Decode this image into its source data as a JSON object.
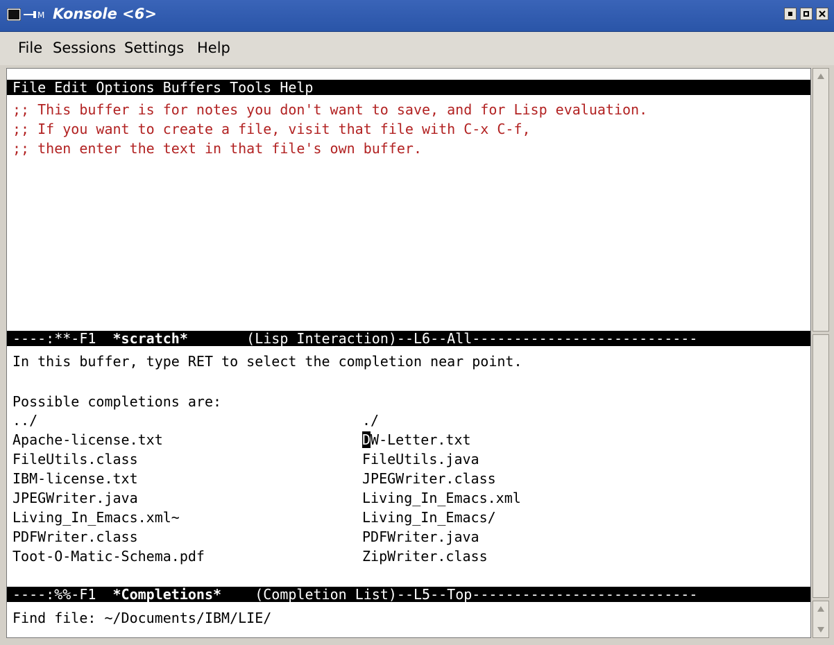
{
  "window": {
    "title": "Konsole <6>"
  },
  "konsole_menu": {
    "items": [
      "File",
      "Sessions",
      "Settings",
      "Help"
    ]
  },
  "emacs_menu": {
    "text": "File Edit Options Buffers Tools Help"
  },
  "scratch": {
    "comments": [
      ";; This buffer is for notes you don't want to save, and for Lisp evaluation.",
      ";; If you want to create a file, visit that file with C-x C-f,",
      ";; then enter the text in that file's own buffer."
    ]
  },
  "modeline_scratch": {
    "prefix": "----:**-F1  ",
    "buffer": "*scratch*",
    "rest": "       (Lisp Interaction)--L6--All---------------------------"
  },
  "completions": {
    "intro": "In this buffer, type RET to select the completion near point.",
    "header": "Possible completions are:",
    "left": [
      "../",
      "Apache-license.txt",
      "FileUtils.class",
      "IBM-license.txt",
      "JPEGWriter.java",
      "Living_In_Emacs.xml~",
      "PDFWriter.class",
      "Toot-O-Matic-Schema.pdf"
    ],
    "right": [
      "./",
      "DW-Letter.txt",
      "FileUtils.java",
      "JPEGWriter.class",
      "Living_In_Emacs.xml",
      "Living_In_Emacs/",
      "PDFWriter.java",
      "ZipWriter.class"
    ],
    "cursor_char": "D",
    "cursor_rest": "W-Letter.txt"
  },
  "modeline_completions": {
    "prefix": "----:%%-F1  ",
    "buffer": "*Completions*",
    "rest": "    (Completion List)--L5--Top---------------------------"
  },
  "minibuffer": {
    "text": "Find file: ~/Documents/IBM/LIE/"
  },
  "colors": {
    "titlebar": "#2a55a8",
    "comment": "#b22222",
    "modeline_bg": "#000000"
  }
}
